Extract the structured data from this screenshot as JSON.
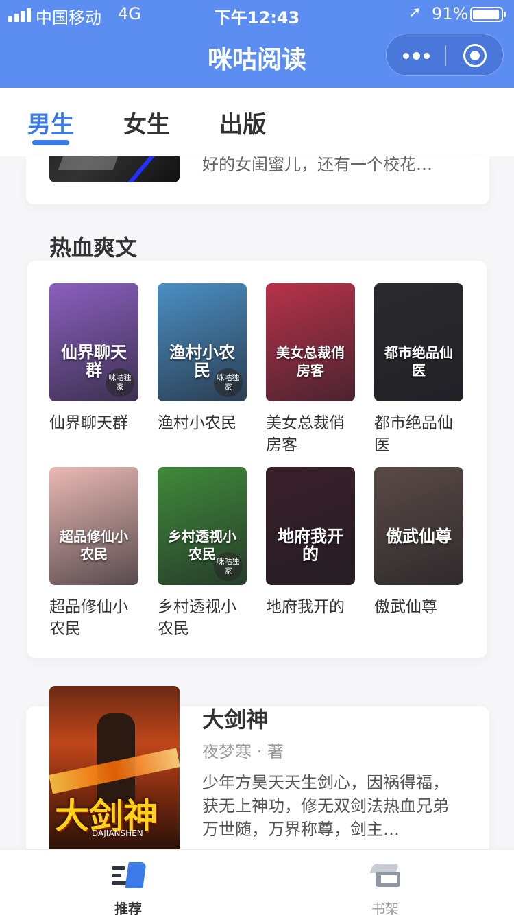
{
  "status_bar": {
    "carrier": "中国移动",
    "network": "4G",
    "time": "下午12:43",
    "battery": "91%",
    "battery_level": 0.91
  },
  "nav": {
    "title": "咪咕阅读"
  },
  "tabs": [
    {
      "label": "男生",
      "active": true
    },
    {
      "label": "女生",
      "active": false
    },
    {
      "label": "出版",
      "active": false
    }
  ],
  "previous_card": {
    "snippet": "好的女闺蜜儿，还有一个校花…"
  },
  "section": {
    "title": "热血爽文",
    "books": [
      {
        "title": "仙界聊天群",
        "cover_text": "仙界聊天群",
        "badge": "咪咕独家",
        "color": "#8a5fbf"
      },
      {
        "title": "渔村小农民",
        "cover_text": "渔村小农民",
        "badge": "咪咕独家",
        "color": "#4a8fc4"
      },
      {
        "title": "美女总裁俏房客",
        "cover_text": "美女总裁俏房客",
        "badge": "",
        "color": "#b8324a"
      },
      {
        "title": "都市绝品仙医",
        "cover_text": "都市绝品仙医",
        "badge": "",
        "color": "#2a2a2e"
      },
      {
        "title": "超品修仙小农民",
        "cover_text": "超品修仙小农民",
        "badge": "",
        "color": "#e9b9b4"
      },
      {
        "title": "乡村透视小农民",
        "cover_text": "乡村透视小农民",
        "badge": "咪咕独家",
        "color": "#3f8a3a"
      },
      {
        "title": "地府我开的",
        "cover_text": "地府我开的",
        "badge": "",
        "color": "#3a1f2a"
      },
      {
        "title": "傲武仙尊",
        "cover_text": "傲武仙尊",
        "badge": "",
        "color": "#5a4a46"
      }
    ]
  },
  "featured": {
    "title": "大剑神",
    "author": "夜梦寒 · 著",
    "description": "少年方昊天天生剑心，因祸得福，获无上神功，修无双剑法热血兄弟万世随，万界称尊，剑主…",
    "cover_title": "大剑神",
    "cover_pinyin": "DAJIANSHEN"
  },
  "tabbar": [
    {
      "label": "推荐",
      "icon": "recommend-icon",
      "active": true
    },
    {
      "label": "书架",
      "icon": "bookshelf-icon",
      "active": false
    }
  ]
}
